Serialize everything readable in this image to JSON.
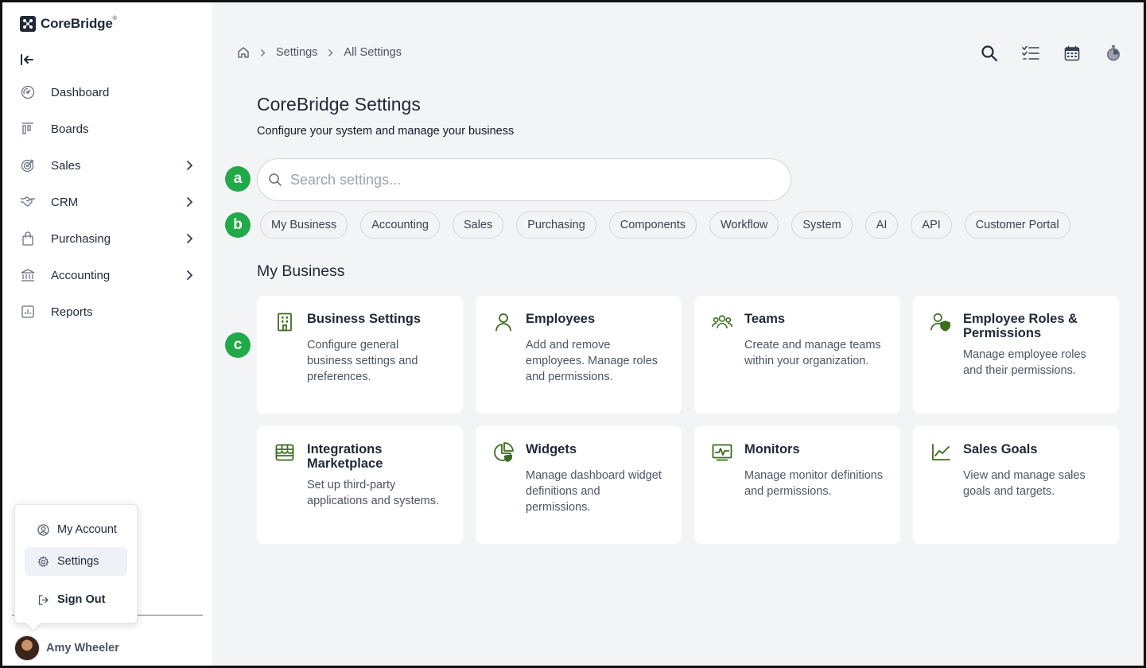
{
  "app": {
    "name": "CoreBridge"
  },
  "sidebar": {
    "items": [
      {
        "label": "Dashboard",
        "icon": "dashboard-gauge-icon",
        "has_submenu": false
      },
      {
        "label": "Boards",
        "icon": "boards-icon",
        "has_submenu": false
      },
      {
        "label": "Sales",
        "icon": "target-icon",
        "has_submenu": true
      },
      {
        "label": "CRM",
        "icon": "handshake-icon",
        "has_submenu": true
      },
      {
        "label": "Purchasing",
        "icon": "shopping-bag-icon",
        "has_submenu": true
      },
      {
        "label": "Accounting",
        "icon": "bank-icon",
        "has_submenu": true
      },
      {
        "label": "Reports",
        "icon": "report-chart-icon",
        "has_submenu": false
      }
    ]
  },
  "user_menu": {
    "items": [
      {
        "label": "My Account",
        "icon": "user-circle-icon"
      },
      {
        "label": "Settings",
        "icon": "gear-icon"
      },
      {
        "label": "Sign Out",
        "icon": "sign-out-icon"
      }
    ],
    "active": "Settings"
  },
  "user": {
    "name": "Amy Wheeler"
  },
  "breadcrumb": {
    "home_icon": "home-icon",
    "items": [
      "Settings",
      "All Settings"
    ]
  },
  "top_icons": [
    "search-icon",
    "tasks-checklist-icon",
    "calendar-icon",
    "stopwatch-icon"
  ],
  "page": {
    "title": "CoreBridge Settings",
    "subtitle": "Configure your system and manage your business"
  },
  "markers": [
    "a",
    "b",
    "c"
  ],
  "search": {
    "placeholder": "Search settings...",
    "value": ""
  },
  "chips": [
    "My Business",
    "Accounting",
    "Sales",
    "Purchasing",
    "Components",
    "Workflow",
    "System",
    "AI",
    "API",
    "Customer Portal"
  ],
  "section": {
    "title": "My Business",
    "cards": [
      {
        "title": "Business Settings",
        "description": "Configure general business settings and preferences.",
        "icon": "building-icon"
      },
      {
        "title": "Employees",
        "description": "Add and remove employees. Manage roles and permissions.",
        "icon": "user-icon"
      },
      {
        "title": "Teams",
        "description": "Create and manage teams within your organization.",
        "icon": "team-icon"
      },
      {
        "title": "Employee Roles & Permissions",
        "description": "Manage employee roles and their permissions.",
        "icon": "user-shield-icon"
      },
      {
        "title": "Integrations Marketplace",
        "description": "Set up third-party applications and systems.",
        "icon": "storefront-icon"
      },
      {
        "title": "Widgets",
        "description": "Manage dashboard widget definitions and permissions.",
        "icon": "pie-chart-icon"
      },
      {
        "title": "Monitors",
        "description": "Manage monitor definitions and permissions.",
        "icon": "monitor-pulse-icon"
      },
      {
        "title": "Sales Goals",
        "description": "View and manage sales goals and targets.",
        "icon": "line-chart-icon"
      }
    ]
  },
  "colors": {
    "accent_green": "#3b6d1e",
    "marker_green": "#22a94a",
    "background": "#f3f4f6"
  }
}
